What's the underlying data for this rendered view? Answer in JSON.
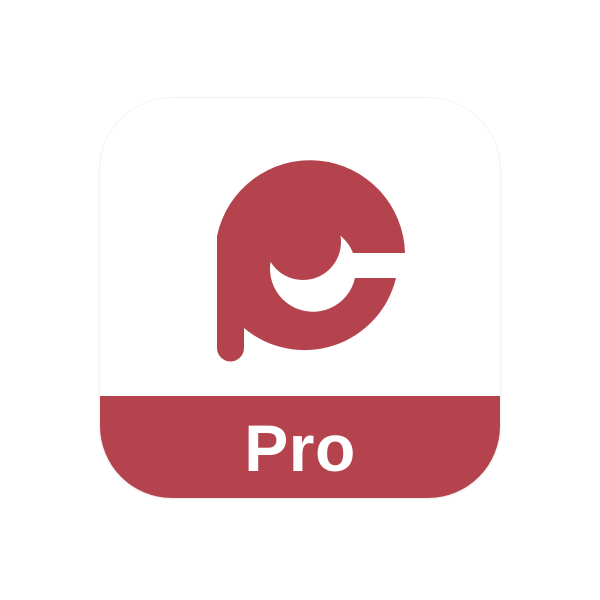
{
  "app_icon": {
    "badge_text": "Pro",
    "logo_icon": "pc-logo-icon",
    "colors": {
      "brand": "#b5434e",
      "background": "#ffffff",
      "badge_text": "#ffffff"
    }
  }
}
